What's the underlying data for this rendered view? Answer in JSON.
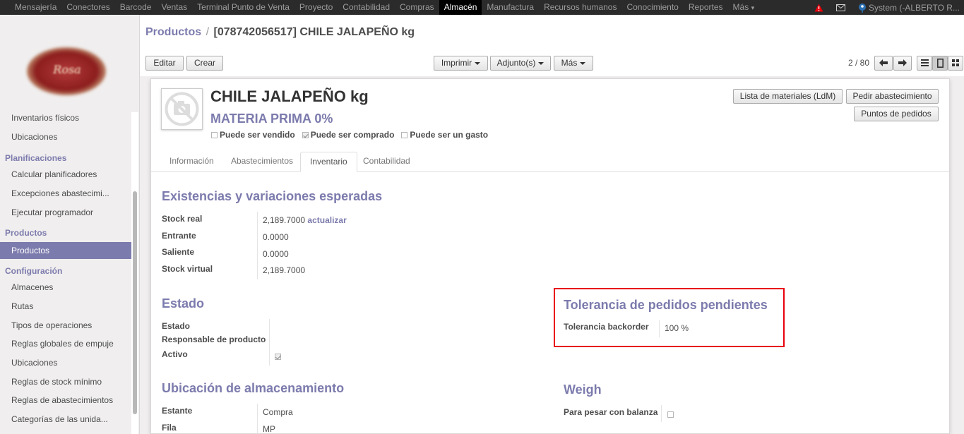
{
  "topnav": {
    "items": [
      "Mensajería",
      "Conectores",
      "Barcode",
      "Ventas",
      "Terminal Punto de Venta",
      "Proyecto",
      "Contabilidad",
      "Compras",
      "Almacén",
      "Manufactura",
      "Recursos humanos",
      "Conocimiento",
      "Reportes",
      "Más"
    ],
    "active_index": 8,
    "user": "System (-ALBERTO R...",
    "icons": [
      "warning-icon",
      "mail-icon",
      "user-avatar-icon"
    ]
  },
  "sidebar": {
    "top_items": [
      "Inventarios físicos",
      "Ubicaciones"
    ],
    "sections": [
      {
        "title": "Planificaciones",
        "items": [
          "Calcular planificadores",
          "Excepciones abastecimi...",
          "Ejecutar programador"
        ]
      },
      {
        "title": "Productos",
        "items": [
          "Productos"
        ],
        "active": "Productos"
      },
      {
        "title": "Configuración",
        "items": [
          "Almacenes",
          "Rutas",
          "Tipos de operaciones",
          "Reglas globales de empuje",
          "Ubicaciones",
          "Reglas de stock mínimo",
          "Reglas de abastecimientos",
          "Categorías de las unida..."
        ]
      }
    ]
  },
  "breadcrumb": {
    "parent": "Productos",
    "separator": "/",
    "current": "[078742056517] CHILE JALAPEÑO kg"
  },
  "toolbar": {
    "edit": "Editar",
    "create": "Crear",
    "print": "Imprimir",
    "attachments": "Adjunto(s)",
    "more": "Más",
    "pager": "2 / 80"
  },
  "product": {
    "name": "CHILE JALAPEÑO kg",
    "category": "MATERIA PRIMA 0%",
    "flags": [
      {
        "label": "Puede ser vendido",
        "checked": false
      },
      {
        "label": "Puede ser comprado",
        "checked": true
      },
      {
        "label": "Puede ser un gasto",
        "checked": false
      }
    ],
    "buttons": {
      "bom": "Lista de materiales (LdM)",
      "procure": "Pedir abastecimiento",
      "reorder": "Puntos de pedidos"
    }
  },
  "tabs": [
    "Información",
    "Abastecimientos",
    "Inventario",
    "Contabilidad"
  ],
  "active_tab": "Inventario",
  "stock": {
    "title": "Existencias y variaciones esperadas",
    "rows": [
      {
        "label": "Stock real",
        "value": "2,189.7000",
        "action": "actualizar"
      },
      {
        "label": "Entrante",
        "value": "0.0000"
      },
      {
        "label": "Saliente",
        "value": "0.0000"
      },
      {
        "label": "Stock virtual",
        "value": "2,189.7000"
      }
    ]
  },
  "estado": {
    "title": "Estado",
    "labels": [
      "Estado",
      "Responsable de producto",
      "Activo"
    ],
    "active_checked": true
  },
  "tolerance": {
    "title": "Tolerancia de pedidos pendientes",
    "label": "Tolerancia backorder",
    "value": "100",
    "unit": "%"
  },
  "storage": {
    "title": "Ubicación de almacenamiento",
    "rows": [
      {
        "label": "Estante",
        "value": "Compra"
      },
      {
        "label": "Fila",
        "value": "MP"
      }
    ]
  },
  "weigh": {
    "title": "Weigh",
    "label": "Para pesar con balanza",
    "checked": false
  }
}
